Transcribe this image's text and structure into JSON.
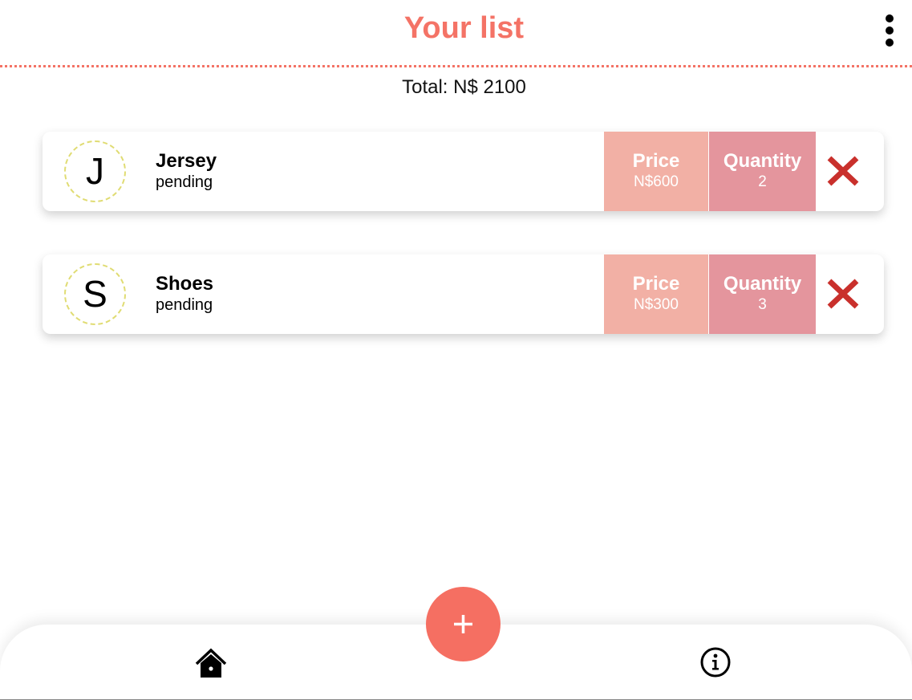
{
  "header": {
    "title": "Your list"
  },
  "summary": {
    "total_text": "Total: N$ 2100"
  },
  "list": {
    "items": [
      {
        "initial": "J",
        "name": "Jersey",
        "status": "pending",
        "price_label": "Price",
        "price": "N$600",
        "quantity_label": "Quantity",
        "quantity": "2"
      },
      {
        "initial": "S",
        "name": "Shoes",
        "status": "pending",
        "price_label": "Price",
        "price": "N$300",
        "quantity_label": "Quantity",
        "quantity": "3"
      }
    ]
  },
  "icons": {
    "menu": "more-vertical-icon",
    "delete": "close-icon",
    "add": "plus-icon",
    "home": "home-icon",
    "info": "info-icon"
  },
  "colors": {
    "accent": "#f47366",
    "fab": "#f56f62",
    "price_bg": "#f2b0a5",
    "quantity_bg": "#e4959d",
    "delete": "#c9302c",
    "avatar_border": "#e0dc73"
  }
}
